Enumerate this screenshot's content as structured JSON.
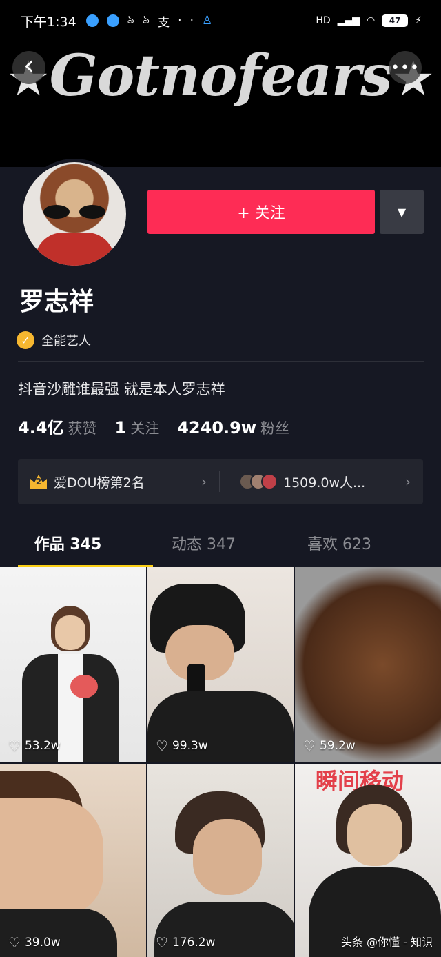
{
  "status_bar": {
    "time": "下午1:34",
    "network": "HD",
    "battery": "47"
  },
  "banner": {
    "title": "Gotnofears",
    "star_left": "★",
    "star_right": "★"
  },
  "nav": {
    "back_icon": "‹",
    "more_icon": "•••"
  },
  "profile": {
    "name": "罗志祥",
    "verification": "全能艺人",
    "bio": "抖音沙雕谁最强 就是本人罗志祥",
    "follow_label": "+ 关注",
    "dropdown_icon": "▼"
  },
  "stats": [
    {
      "value": "4.4亿",
      "label": "获赞"
    },
    {
      "value": "1",
      "label": "关注"
    },
    {
      "value": "4240.9w",
      "label": "粉丝"
    }
  ],
  "rank": {
    "crown_number": "2",
    "label": "爱DOU榜第2名",
    "fans_label": "1509.0w人..."
  },
  "tabs": [
    {
      "label": "作品 345",
      "active": true
    },
    {
      "label": "动态 347",
      "active": false
    },
    {
      "label": "喜欢 623",
      "active": false
    }
  ],
  "videos": [
    {
      "likes": "53.2w"
    },
    {
      "likes": "99.3w"
    },
    {
      "likes": "59.2w"
    },
    {
      "likes": "39.0w"
    },
    {
      "likes": "176.2w"
    },
    {
      "likes": ""
    }
  ],
  "video_overlay_text": "瞬间移动",
  "watermark": "头条 @你懂 - 知识"
}
